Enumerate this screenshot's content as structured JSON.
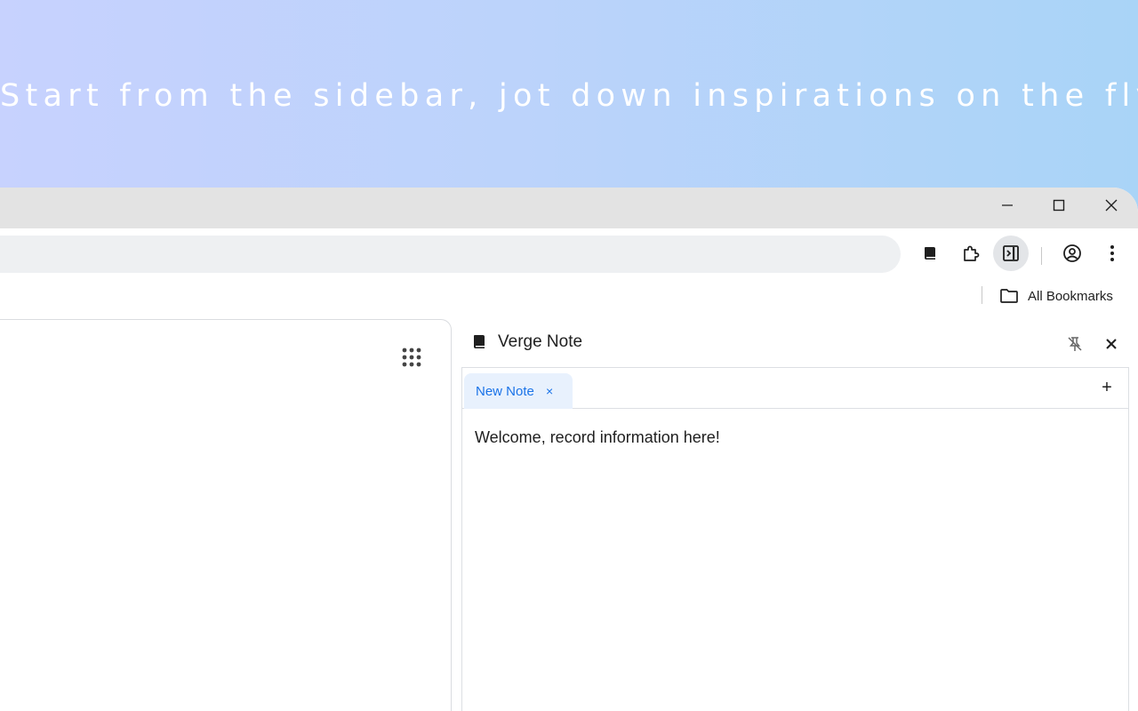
{
  "promo": {
    "headline": "Start from the sidebar, jot down inspirations on the fly."
  },
  "window_controls": {
    "minimize_icon": "minimize-icon",
    "maximize_icon": "maximize-icon",
    "close_icon": "close-icon"
  },
  "toolbar": {
    "icons": [
      "verge-note-extension-icon",
      "extensions-puzzle-icon",
      "side-panel-icon",
      "profile-icon",
      "more-menu-icon"
    ]
  },
  "bookmarks_bar": {
    "all_bookmarks_label": "All Bookmarks"
  },
  "side_panel": {
    "title": "Verge Note",
    "tabs": [
      {
        "label": "New Note",
        "close_glyph": "×"
      }
    ],
    "add_button_glyph": "+",
    "editor_text": "Welcome, record information here!"
  },
  "colors": {
    "accent": "#1a73e8",
    "tab_active_bg": "#e8f1fd",
    "titlebar_bg": "#e3e3e3",
    "omnibox_bg": "#eef0f2"
  }
}
